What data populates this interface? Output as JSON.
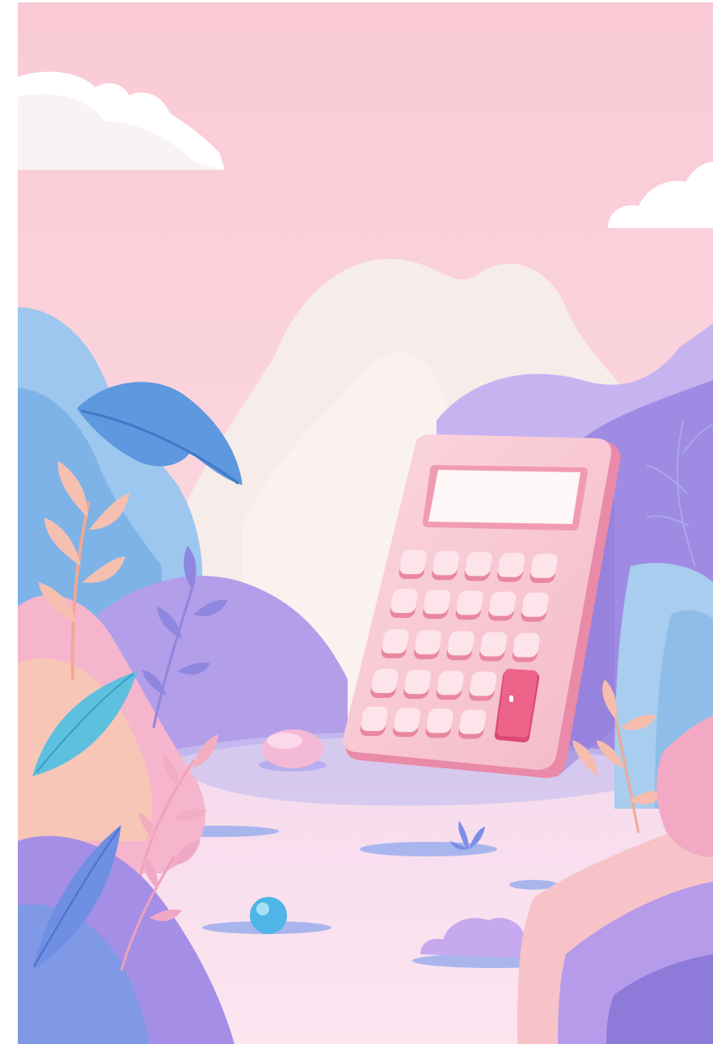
{
  "scene": {
    "subject": "calculator",
    "calculator": {
      "key_rows": 5,
      "key_cols": 5,
      "accent_key": "tall-pink-key"
    },
    "colors": {
      "sky": "#fbd3dd",
      "sky_top": "#f9cad6",
      "cloud": "#ffffff",
      "mist": "#f6ece9",
      "lavender": "#b9a2ec",
      "purple": "#8d7ad9",
      "blue": "#6ea8e6",
      "light_blue": "#a8d0f0",
      "pink": "#f3a9c4",
      "peach": "#f7c6b6",
      "calc_body": "#f8c7d3",
      "calc_side": "#e98aa8",
      "key": "#fde3ea",
      "key_shadow": "#e9879f",
      "accent_key": "#ec5f84",
      "ground": "#fde6ee",
      "ground_shadow": "#b8b4ec"
    }
  }
}
